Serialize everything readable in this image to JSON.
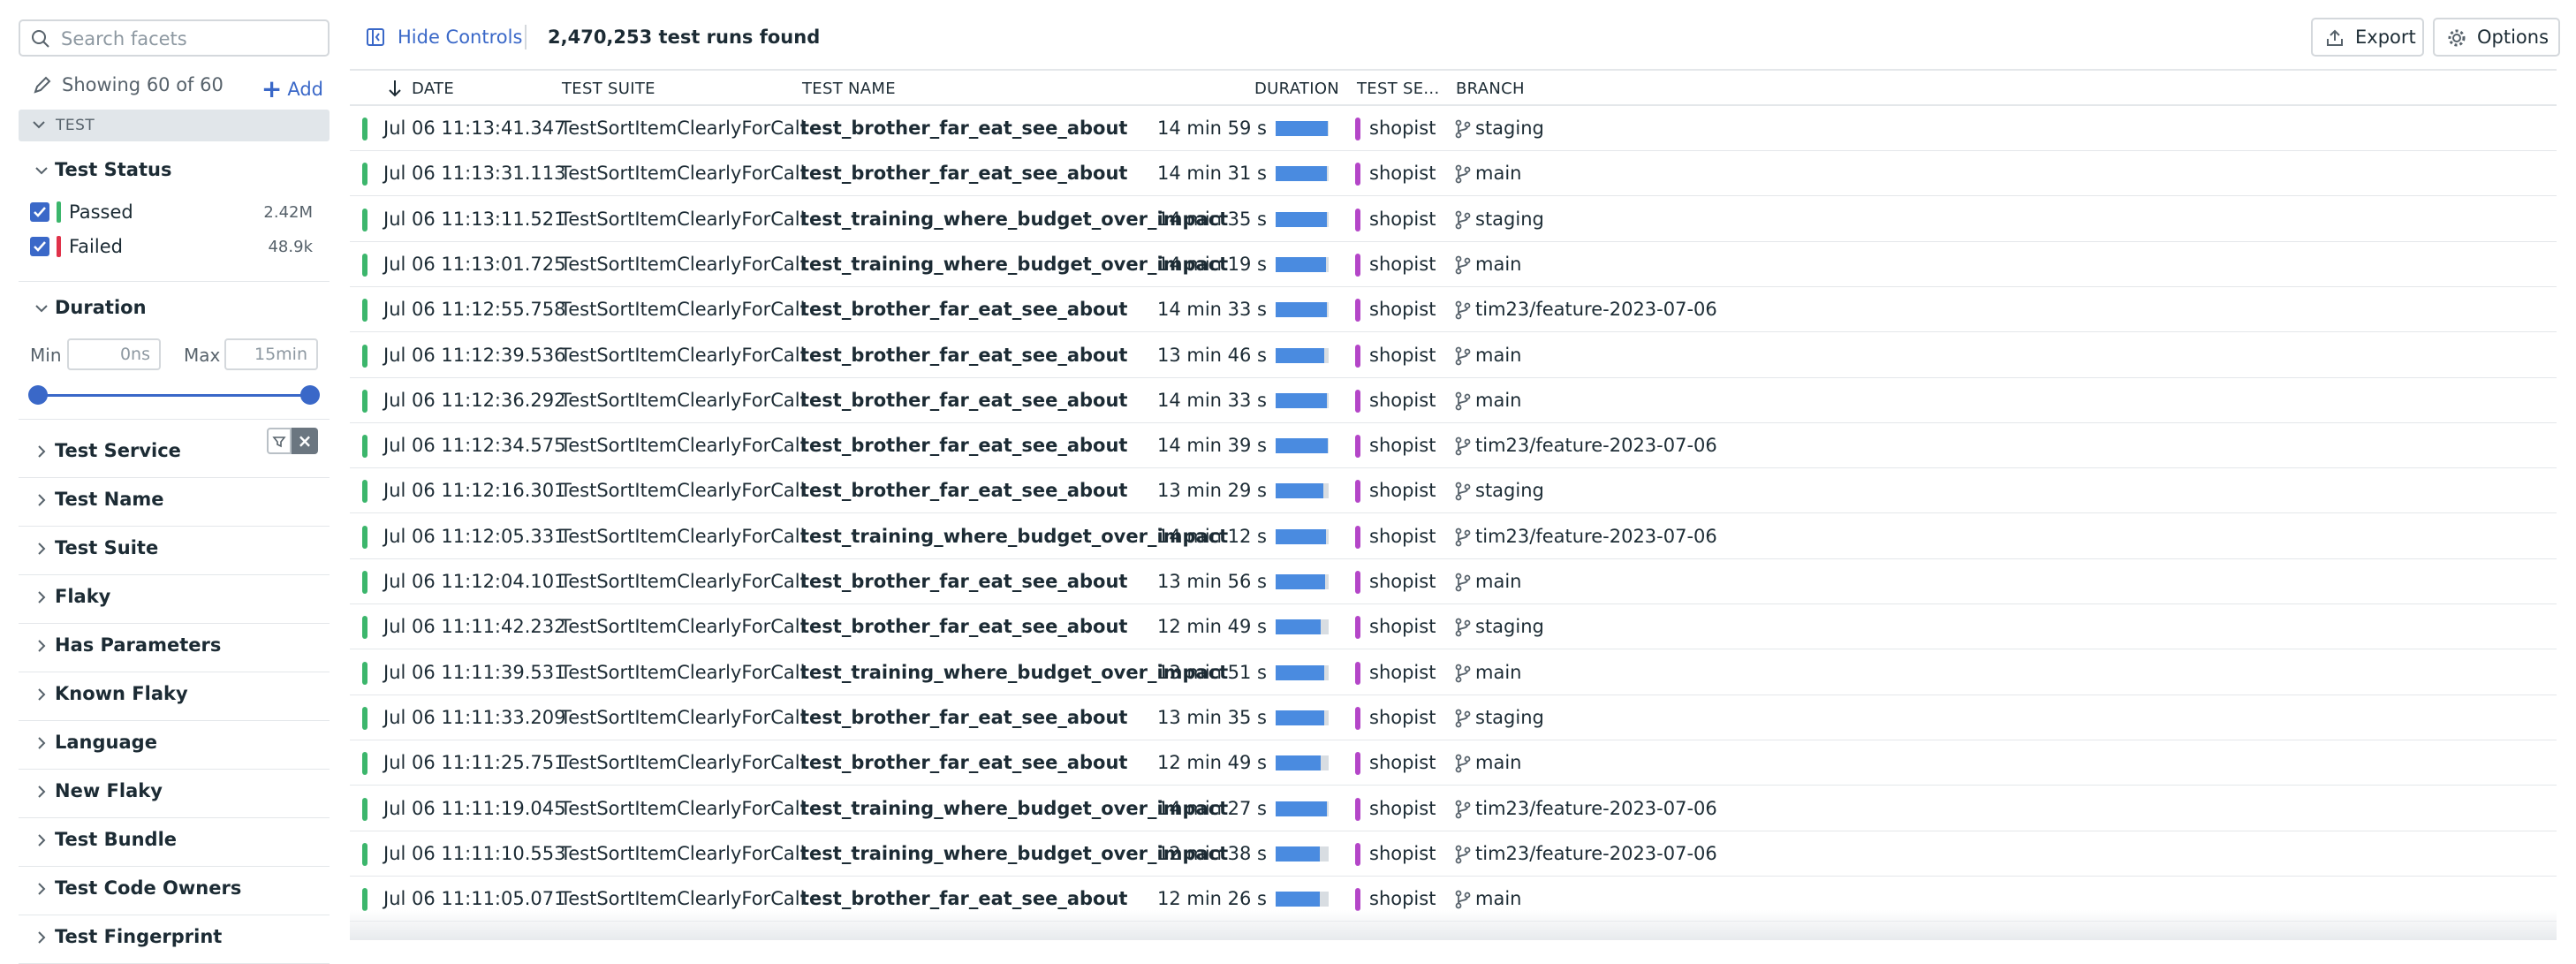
{
  "sidebar": {
    "search_placeholder": "Search facets",
    "showing_text": "Showing 60 of 60",
    "add_label": "Add",
    "section_label": "TEST",
    "test_status": {
      "title": "Test Status",
      "items": [
        {
          "label": "Passed",
          "count": "2.42M",
          "color": "#3cb66c"
        },
        {
          "label": "Failed",
          "count": "48.9k",
          "color": "#e0324a"
        }
      ]
    },
    "duration": {
      "title": "Duration",
      "min_label": "Min",
      "min_placeholder": "0ns",
      "max_label": "Max",
      "max_placeholder": "15min"
    },
    "facets": [
      "Test Service",
      "Test Name",
      "Test Suite",
      "Flaky",
      "Has Parameters",
      "Known Flaky",
      "Language",
      "New Flaky",
      "Test Bundle",
      "Test Code Owners",
      "Test Fingerprint"
    ]
  },
  "toolbar": {
    "hide_controls": "Hide Controls",
    "found": "2,470,253 test runs found",
    "export": "Export",
    "options": "Options"
  },
  "table": {
    "columns": [
      "DATE",
      "TEST SUITE",
      "TEST NAME",
      "DURATION",
      "TEST SE...",
      "BRANCH"
    ],
    "rows": [
      {
        "date": "Jul 06 11:13:41.347",
        "suite": "TestSortItemClearlyForCall",
        "name": "test_brother_far_eat_see_about",
        "duration": "14 min 59 s",
        "pct": 0.99,
        "service": "shopist",
        "branch": "staging"
      },
      {
        "date": "Jul 06 11:13:31.113",
        "suite": "TestSortItemClearlyForCall",
        "name": "test_brother_far_eat_see_about",
        "duration": "14 min 31 s",
        "pct": 0.96,
        "service": "shopist",
        "branch": "main"
      },
      {
        "date": "Jul 06 11:13:11.521",
        "suite": "TestSortItemClearlyForCall",
        "name": "test_training_where_budget_over_impact",
        "duration": "14 min 35 s",
        "pct": 0.97,
        "service": "shopist",
        "branch": "staging"
      },
      {
        "date": "Jul 06 11:13:01.725",
        "suite": "TestSortItemClearlyForCall",
        "name": "test_training_where_budget_over_impact",
        "duration": "14 min 19 s",
        "pct": 0.95,
        "service": "shopist",
        "branch": "main"
      },
      {
        "date": "Jul 06 11:12:55.758",
        "suite": "TestSortItemClearlyForCall",
        "name": "test_brother_far_eat_see_about",
        "duration": "14 min 33 s",
        "pct": 0.97,
        "service": "shopist",
        "branch": "tim23/feature-2023-07-06"
      },
      {
        "date": "Jul 06 11:12:39.536",
        "suite": "TestSortItemClearlyForCall",
        "name": "test_brother_far_eat_see_about",
        "duration": "13 min 46 s",
        "pct": 0.92,
        "service": "shopist",
        "branch": "main"
      },
      {
        "date": "Jul 06 11:12:36.292",
        "suite": "TestSortItemClearlyForCall",
        "name": "test_brother_far_eat_see_about",
        "duration": "14 min 33 s",
        "pct": 0.97,
        "service": "shopist",
        "branch": "main"
      },
      {
        "date": "Jul 06 11:12:34.575",
        "suite": "TestSortItemClearlyForCall",
        "name": "test_brother_far_eat_see_about",
        "duration": "14 min 39 s",
        "pct": 0.98,
        "service": "shopist",
        "branch": "tim23/feature-2023-07-06"
      },
      {
        "date": "Jul 06 11:12:16.301",
        "suite": "TestSortItemClearlyForCall",
        "name": "test_brother_far_eat_see_about",
        "duration": "13 min 29 s",
        "pct": 0.9,
        "service": "shopist",
        "branch": "staging"
      },
      {
        "date": "Jul 06 11:12:05.331",
        "suite": "TestSortItemClearlyForCall",
        "name": "test_training_where_budget_over_impact",
        "duration": "14 min 12 s",
        "pct": 0.95,
        "service": "shopist",
        "branch": "tim23/feature-2023-07-06"
      },
      {
        "date": "Jul 06 11:12:04.101",
        "suite": "TestSortItemClearlyForCall",
        "name": "test_brother_far_eat_see_about",
        "duration": "13 min 56 s",
        "pct": 0.93,
        "service": "shopist",
        "branch": "main"
      },
      {
        "date": "Jul 06 11:11:42.232",
        "suite": "TestSortItemClearlyForCall",
        "name": "test_brother_far_eat_see_about",
        "duration": "12 min 49 s",
        "pct": 0.85,
        "service": "shopist",
        "branch": "staging"
      },
      {
        "date": "Jul 06 11:11:39.531",
        "suite": "TestSortItemClearlyForCall",
        "name": "test_training_where_budget_over_impact",
        "duration": "13 min 51 s",
        "pct": 0.92,
        "service": "shopist",
        "branch": "main"
      },
      {
        "date": "Jul 06 11:11:33.209",
        "suite": "TestSortItemClearlyForCall",
        "name": "test_brother_far_eat_see_about",
        "duration": "13 min 35 s",
        "pct": 0.91,
        "service": "shopist",
        "branch": "staging"
      },
      {
        "date": "Jul 06 11:11:25.751",
        "suite": "TestSortItemClearlyForCall",
        "name": "test_brother_far_eat_see_about",
        "duration": "12 min 49 s",
        "pct": 0.85,
        "service": "shopist",
        "branch": "main"
      },
      {
        "date": "Jul 06 11:11:19.045",
        "suite": "TestSortItemClearlyForCall",
        "name": "test_training_where_budget_over_impact",
        "duration": "14 min 27 s",
        "pct": 0.96,
        "service": "shopist",
        "branch": "tim23/feature-2023-07-06"
      },
      {
        "date": "Jul 06 11:11:10.553",
        "suite": "TestSortItemClearlyForCall",
        "name": "test_training_where_budget_over_impact",
        "duration": "12 min 38 s",
        "pct": 0.84,
        "service": "shopist",
        "branch": "tim23/feature-2023-07-06"
      },
      {
        "date": "Jul 06 11:11:05.071",
        "suite": "TestSortItemClearlyForCall",
        "name": "test_brother_far_eat_see_about",
        "duration": "12 min 26 s",
        "pct": 0.83,
        "service": "shopist",
        "branch": "main"
      }
    ]
  }
}
